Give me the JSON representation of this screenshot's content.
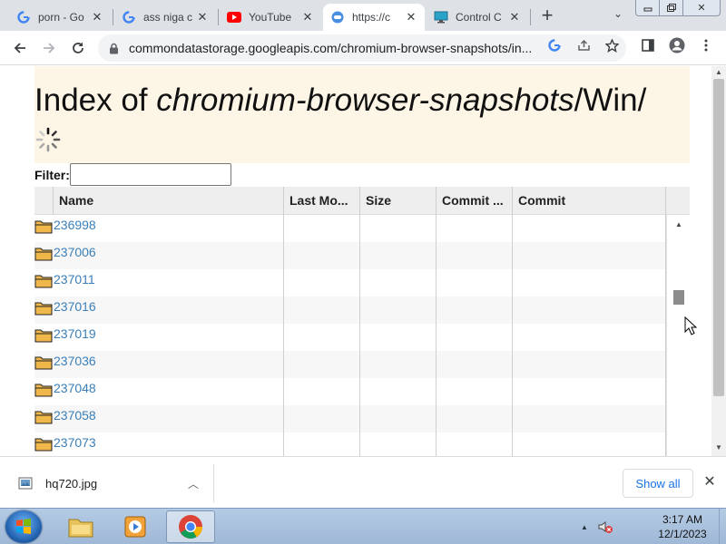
{
  "tabs": [
    {
      "title": "porn - Go",
      "favicon": "google-g-icon",
      "active": false
    },
    {
      "title": "ass niga c",
      "favicon": "google-g-icon",
      "active": false
    },
    {
      "title": "YouTube",
      "favicon": "youtube-icon",
      "active": false
    },
    {
      "title": "https://c",
      "favicon": "globe-icon",
      "active": true
    },
    {
      "title": "Control C",
      "favicon": "monitor-icon",
      "active": false
    }
  ],
  "toolbar": {
    "url": "commondatastorage.googleapis.com/chromium-browser-snapshots/in..."
  },
  "page": {
    "title_prefix": "Index of ",
    "title_italic": "chromium-browser-snapshots",
    "title_suffix": "/Win/",
    "filter_label": "Filter:",
    "filter_value": "",
    "columns": [
      "Name",
      "Last Mo...",
      "Size",
      "Commit ...",
      "Commit"
    ],
    "rows": [
      "236998",
      "237006",
      "237011",
      "237016",
      "237019",
      "237036",
      "237048",
      "237058",
      "237073"
    ]
  },
  "downloads": {
    "file_name": "hq720.jpg",
    "show_all_label": "Show all"
  },
  "taskbar": {
    "time": "3:17 AM",
    "date": "12/1/2023"
  },
  "colors": {
    "header_band": "#fdf5e6",
    "link": "#3b7fb8",
    "show_all": "#1a73e8"
  }
}
